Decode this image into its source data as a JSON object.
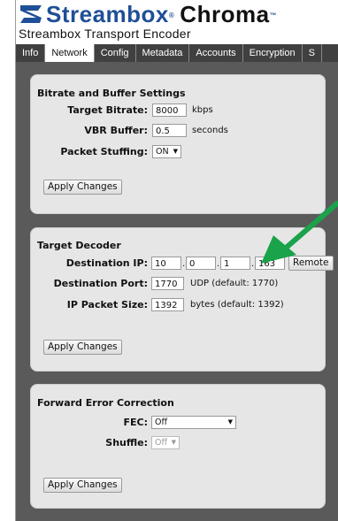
{
  "header": {
    "brand": "Streambox",
    "brand_reg": "®",
    "product": "Chroma",
    "product_tm": "™",
    "subtitle": "Streambox Transport Encoder"
  },
  "tabs": [
    {
      "label": "Info"
    },
    {
      "label": "Network",
      "active": true
    },
    {
      "label": "Config"
    },
    {
      "label": "Metadata"
    },
    {
      "label": "Accounts"
    },
    {
      "label": "Encryption"
    },
    {
      "label": "S"
    }
  ],
  "bitrate": {
    "title": "Bitrate and Buffer Settings",
    "target_bitrate_label": "Target Bitrate:",
    "target_bitrate_value": "8000",
    "target_bitrate_unit": "kbps",
    "vbr_buffer_label": "VBR Buffer:",
    "vbr_buffer_value": "0.5",
    "vbr_buffer_unit": "seconds",
    "packet_stuffing_label": "Packet Stuffing:",
    "packet_stuffing_value": "ON",
    "apply_label": "Apply Changes"
  },
  "decoder": {
    "title": "Target Decoder",
    "dest_ip_label": "Destination IP:",
    "ip": [
      "10",
      "0",
      "1",
      "163"
    ],
    "ip_sep": ".",
    "remote_label": "Remote",
    "dest_port_label": "Destination Port:",
    "dest_port_value": "1770",
    "dest_port_hint": "UDP (default: 1770)",
    "packet_size_label": "IP Packet Size:",
    "packet_size_value": "1392",
    "packet_size_hint": "bytes (default: 1392)",
    "apply_label": "Apply Changes"
  },
  "fec": {
    "title": "Forward Error Correction",
    "fec_label": "FEC:",
    "fec_value": "Off",
    "shuffle_label": "Shuffle:",
    "shuffle_value": "Off",
    "apply_label": "Apply Changes"
  },
  "colors": {
    "brand_blue": "#1f4f96",
    "tab_bar": "#404040",
    "page_bg": "#5a5a5a",
    "panel_bg": "#e6e6e6",
    "annotation_arrow": "#1aa34a"
  }
}
